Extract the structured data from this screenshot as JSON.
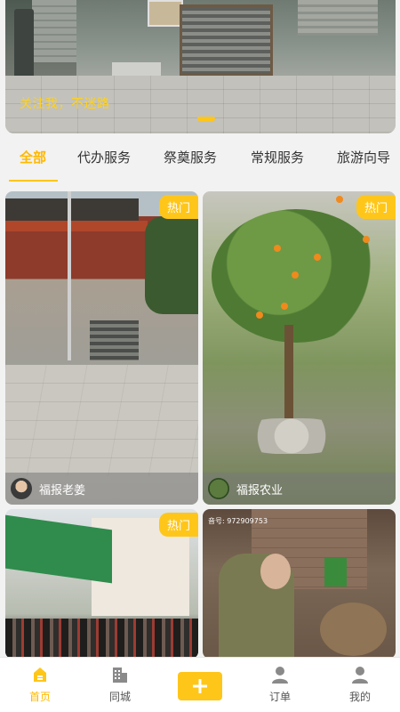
{
  "banner": {
    "caption": "关注我，不迷路"
  },
  "tabs": [
    "全部",
    "代办服务",
    "祭奠服务",
    "常规服务",
    "旅游向导"
  ],
  "cards": [
    {
      "badge": "热门",
      "author": "福报老姜"
    },
    {
      "badge": "热门",
      "author": "福报农业"
    },
    {
      "badge": "热门",
      "author": ""
    },
    {
      "badge": "",
      "author": "",
      "overlay_text": "音号: 972909753"
    }
  ],
  "bottom_nav": {
    "home": "首页",
    "city": "同城",
    "orders": "订单",
    "mine": "我的"
  },
  "colors": {
    "accent": "#ffc61a",
    "active_text": "#ffb800"
  }
}
